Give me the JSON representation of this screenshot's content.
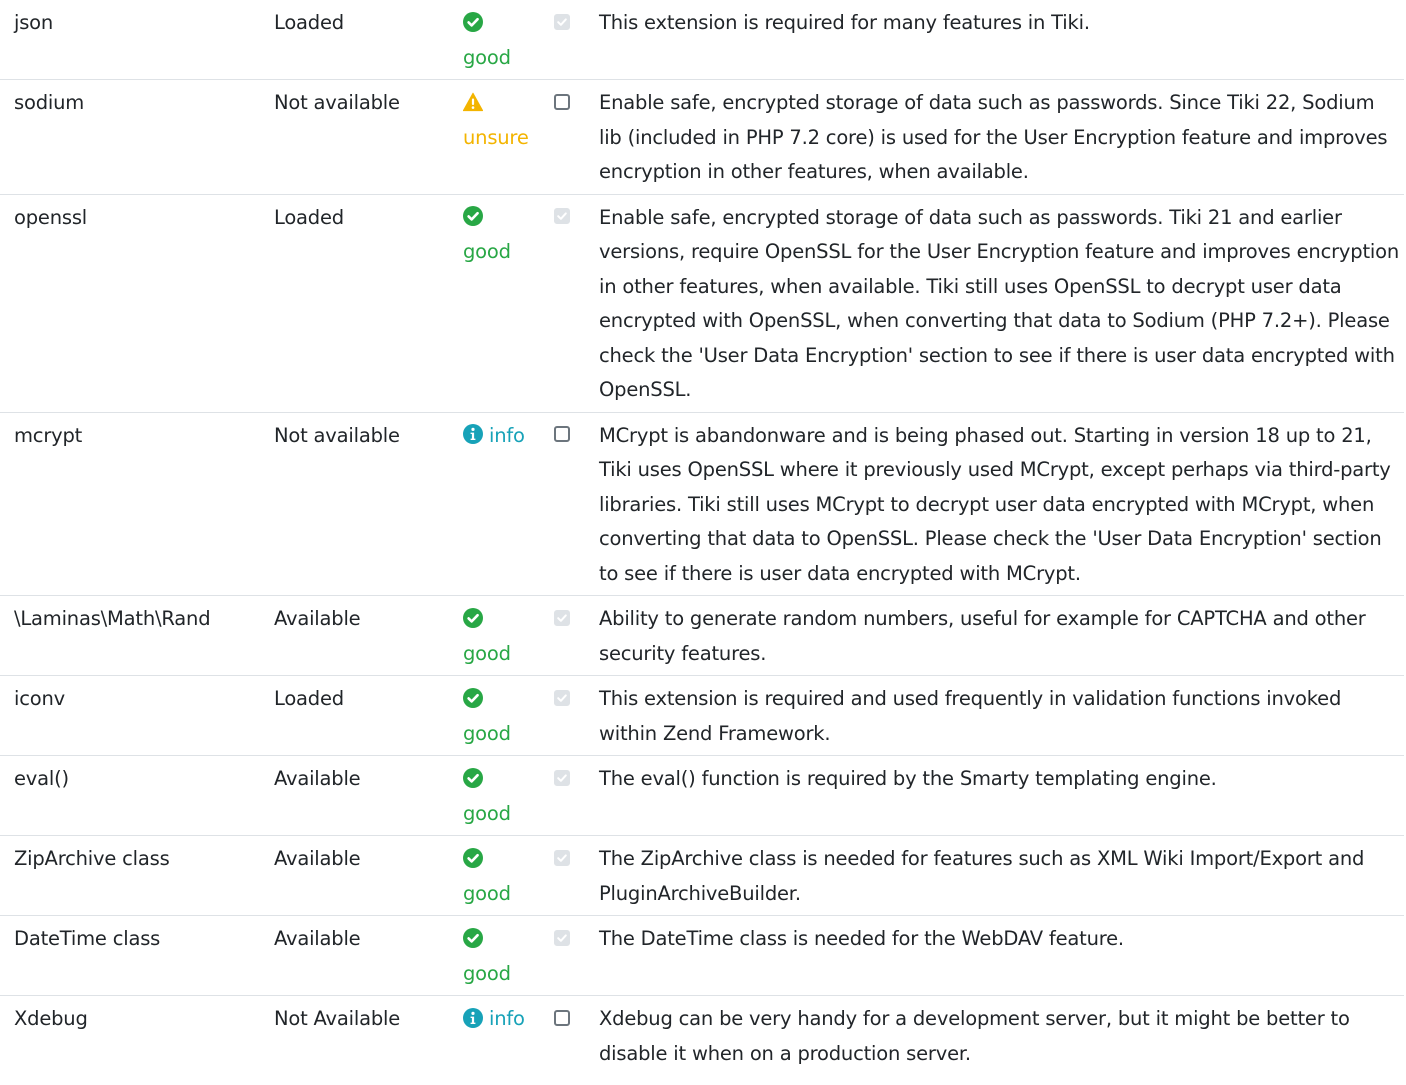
{
  "colors": {
    "good": "#28a745",
    "unsure": "#f3b400",
    "info": "#17a2b8",
    "border": "#dee2e6",
    "text": "#212529"
  },
  "icons": {
    "good": "check-circle-icon",
    "unsure": "warning-triangle-icon",
    "info": "info-circle-icon"
  },
  "rows": [
    {
      "name": "json",
      "availability": "Loaded",
      "status": "good",
      "status_label": "good",
      "checked": true,
      "message": "This extension is required for many features in Tiki."
    },
    {
      "name": "sodium",
      "availability": "Not available",
      "status": "unsure",
      "status_label": "unsure",
      "checked": false,
      "message": "Enable safe, encrypted storage of data such as passwords. Since Tiki 22, Sodium lib (included in PHP 7.2 core) is used for the User Encryption feature and improves encryption in other features, when available."
    },
    {
      "name": "openssl",
      "availability": "Loaded",
      "status": "good",
      "status_label": "good",
      "checked": true,
      "message": "Enable safe, encrypted storage of data such as passwords. Tiki 21 and earlier versions, require OpenSSL for the User Encryption feature and improves encryption in other features, when available. Tiki still uses OpenSSL to decrypt user data encrypted with OpenSSL, when converting that data to Sodium (PHP 7.2+). Please check the 'User Data Encryption' section to see if there is user data encrypted with OpenSSL."
    },
    {
      "name": "mcrypt",
      "availability": "Not available",
      "status": "info",
      "status_label": "info",
      "checked": false,
      "message": "MCrypt is abandonware and is being phased out. Starting in version 18 up to 21, Tiki uses OpenSSL where it previously used MCrypt, except perhaps via third-party libraries. Tiki still uses MCrypt to decrypt user data encrypted with MCrypt, when converting that data to OpenSSL. Please check the 'User Data Encryption' section to see if there is user data encrypted with MCrypt."
    },
    {
      "name": "\\Laminas\\Math\\Rand",
      "availability": "Available",
      "status": "good",
      "status_label": "good",
      "checked": true,
      "message": "Ability to generate random numbers, useful for example for CAPTCHA and other security features."
    },
    {
      "name": "iconv",
      "availability": "Loaded",
      "status": "good",
      "status_label": "good",
      "checked": true,
      "message": "This extension is required and used frequently in validation functions invoked within Zend Framework."
    },
    {
      "name": "eval()",
      "availability": "Available",
      "status": "good",
      "status_label": "good",
      "checked": true,
      "message": "The eval() function is required by the Smarty templating engine."
    },
    {
      "name": "ZipArchive class",
      "availability": "Available",
      "status": "good",
      "status_label": "good",
      "checked": true,
      "message": "The ZipArchive class is needed for features such as XML Wiki Import/Export and PluginArchiveBuilder."
    },
    {
      "name": "DateTime class",
      "availability": "Available",
      "status": "good",
      "status_label": "good",
      "checked": true,
      "message": "The DateTime class is needed for the WebDAV feature."
    },
    {
      "name": "Xdebug",
      "availability": "Not Available",
      "status": "info",
      "status_label": "info",
      "checked": false,
      "message": "Xdebug can be very handy for a development server, but it might be better to disable it when on a production server."
    }
  ]
}
